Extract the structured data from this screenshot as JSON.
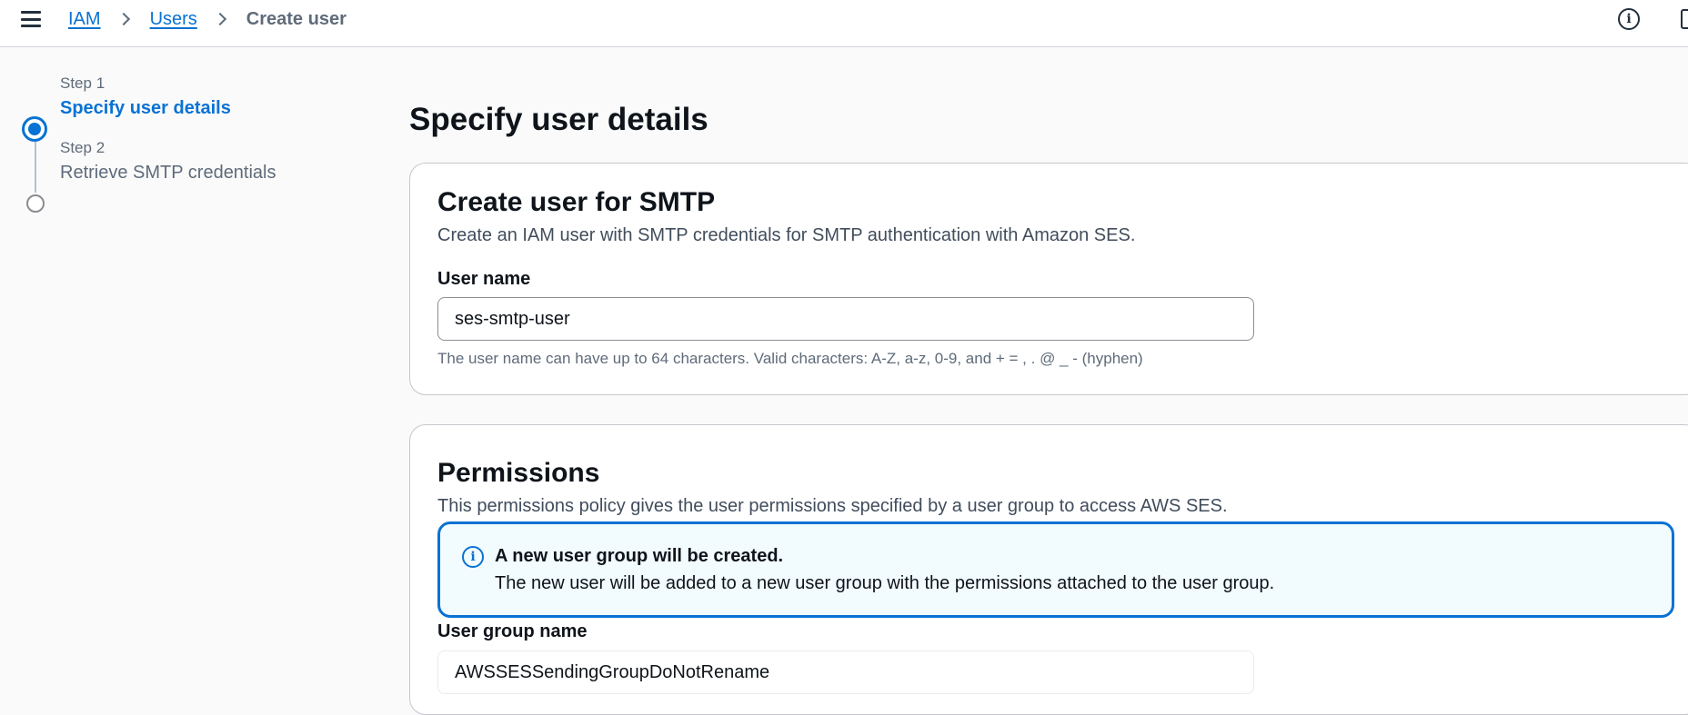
{
  "breadcrumb": {
    "iam": "IAM",
    "users": "Users",
    "current": "Create user"
  },
  "steps": [
    {
      "label": "Step 1",
      "title": "Specify user details",
      "state": "active"
    },
    {
      "label": "Step 2",
      "title": "Retrieve SMTP credentials",
      "state": "inactive"
    }
  ],
  "page": {
    "title": "Specify user details"
  },
  "smtp_card": {
    "title": "Create user for SMTP",
    "description": "Create an IAM user with SMTP credentials for SMTP authentication with Amazon SES.",
    "user_name_label": "User name",
    "user_name_value": "ses-smtp-user",
    "user_name_hint": "The user name can have up to 64 characters. Valid characters: A-Z, a-z, 0-9, and + = , . @ _ - (hyphen)"
  },
  "permissions_card": {
    "title": "Permissions",
    "description": "This permissions policy gives the user permissions specified by a user group to access AWS SES.",
    "alert_title": "A new user group will be created.",
    "alert_text": "The new user will be added to a new user group with the permissions attached to the user group.",
    "group_name_label": "User group name",
    "group_name_value": "AWSSESSendingGroupDoNotRename"
  },
  "colors": {
    "accent": "#0972d3",
    "alert_bg": "#f2fbfe",
    "text": "#0f141a",
    "muted": "#5f6b7a"
  },
  "icons": {
    "menu": "hamburger-menu-icon",
    "info": "info-icon",
    "alert": "info-circle-icon"
  }
}
